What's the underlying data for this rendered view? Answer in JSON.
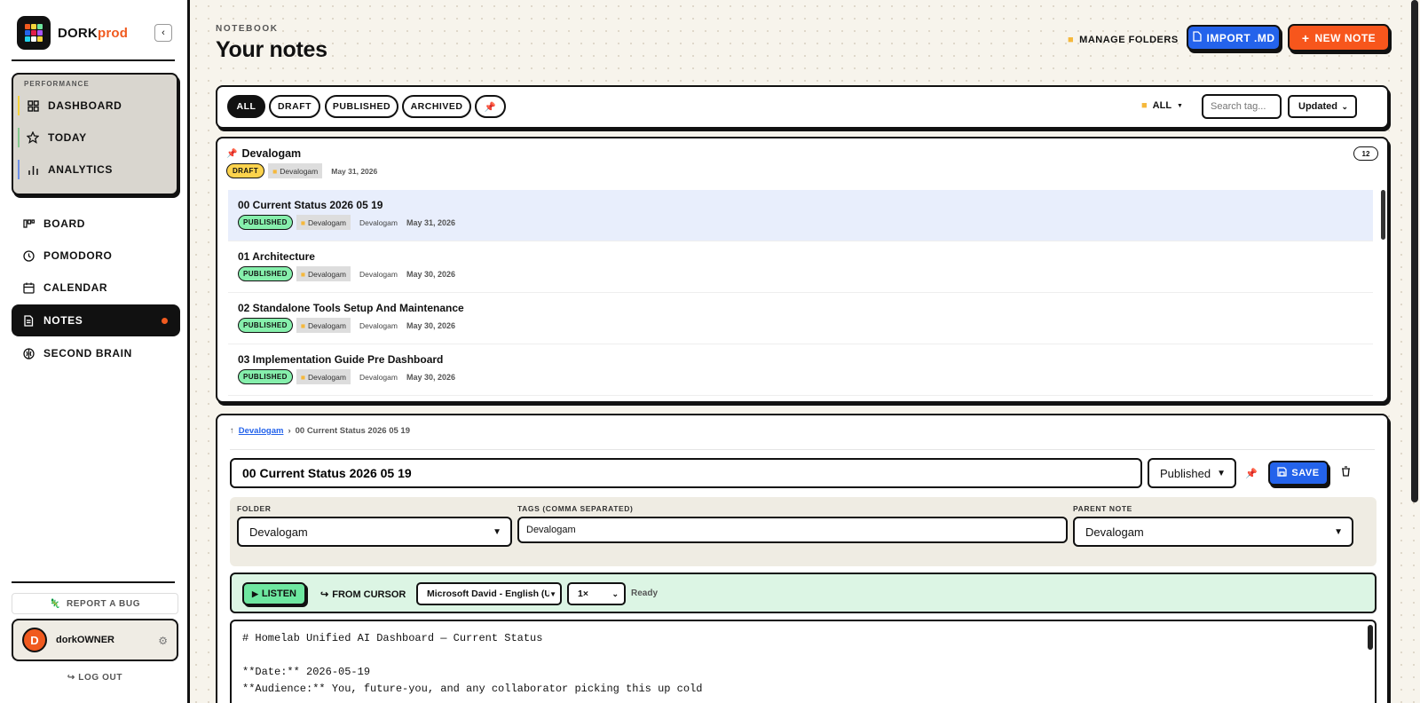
{
  "brand": {
    "name_main": "DORK",
    "name_accent": "prod"
  },
  "sidebar": {
    "performance_title": "PERFORMANCE",
    "performance_items": [
      {
        "label": "DASHBOARD",
        "icon": "grid-icon",
        "accent": "#f5d33b"
      },
      {
        "label": "TODAY",
        "icon": "star-icon",
        "accent": "#86c98f"
      },
      {
        "label": "ANALYTICS",
        "icon": "bar-chart-icon",
        "accent": "#6c8fe6"
      }
    ],
    "nav_items": [
      {
        "label": "BOARD",
        "icon": "kanban-icon"
      },
      {
        "label": "POMODORO",
        "icon": "clock-icon"
      },
      {
        "label": "CALENDAR",
        "icon": "calendar-icon"
      },
      {
        "label": "NOTES",
        "icon": "document-icon",
        "active": true
      },
      {
        "label": "SECOND BRAIN",
        "icon": "brain-icon"
      }
    ],
    "report_bug": "REPORT A BUG",
    "user": {
      "initial": "D",
      "name": "dorkOWNER"
    },
    "logout": "LOG OUT"
  },
  "header": {
    "eyebrow": "NOTEBOOK",
    "title": "Your notes",
    "manage_folders": "MANAGE FOLDERS",
    "import": "IMPORT .MD",
    "new_note": "NEW NOTE"
  },
  "filters": {
    "chips": [
      "ALL",
      "DRAFT",
      "PUBLISHED",
      "ARCHIVED"
    ],
    "folder": "ALL",
    "tag_placeholder": "Search tag...",
    "sort": "Updated"
  },
  "group": {
    "title": "Devalogam",
    "status": "DRAFT",
    "folder": "Devalogam",
    "date": "May 31, 2026",
    "count": "12"
  },
  "notes": [
    {
      "title": "00 Current Status 2026 05 19",
      "status": "PUBLISHED",
      "folder": "Devalogam",
      "tag": "Devalogam",
      "date": "May 31, 2026",
      "selected": true
    },
    {
      "title": "01 Architecture",
      "status": "PUBLISHED",
      "folder": "Devalogam",
      "tag": "Devalogam",
      "date": "May 30, 2026"
    },
    {
      "title": "02 Standalone Tools Setup And Maintenance",
      "status": "PUBLISHED",
      "folder": "Devalogam",
      "tag": "Devalogam",
      "date": "May 30, 2026"
    },
    {
      "title": "03 Implementation Guide Pre Dashboard",
      "status": "PUBLISHED",
      "folder": "Devalogam",
      "tag": "Devalogam",
      "date": "May 30, 2026"
    }
  ],
  "editor": {
    "breadcrumb_parent": "Devalogam",
    "breadcrumb_current": "00 Current Status 2026 05 19",
    "title": "00 Current Status 2026 05 19",
    "status": "Published",
    "save": "SAVE",
    "folder_label": "FOLDER",
    "folder_value": "Devalogam",
    "tags_label": "TAGS (COMMA SEPARATED)",
    "tags_value": "Devalogam",
    "parent_label": "PARENT NOTE",
    "parent_value": "Devalogam",
    "listen": "LISTEN",
    "from_cursor": "FROM CURSOR",
    "voice": "Microsoft David - English (United States)",
    "speed": "1×",
    "tts_status": "Ready",
    "content_lines": [
      "# Homelab Unified AI Dashboard — Current Status",
      "",
      "**Date:** 2026-05-19",
      "**Audience:** You, future-you, and any collaborator picking this up cold"
    ]
  },
  "colors": {
    "accent_orange": "#f7561c",
    "accent_blue": "#2463eb",
    "published_green": "#86efac",
    "draft_yellow": "#fcd34d"
  }
}
